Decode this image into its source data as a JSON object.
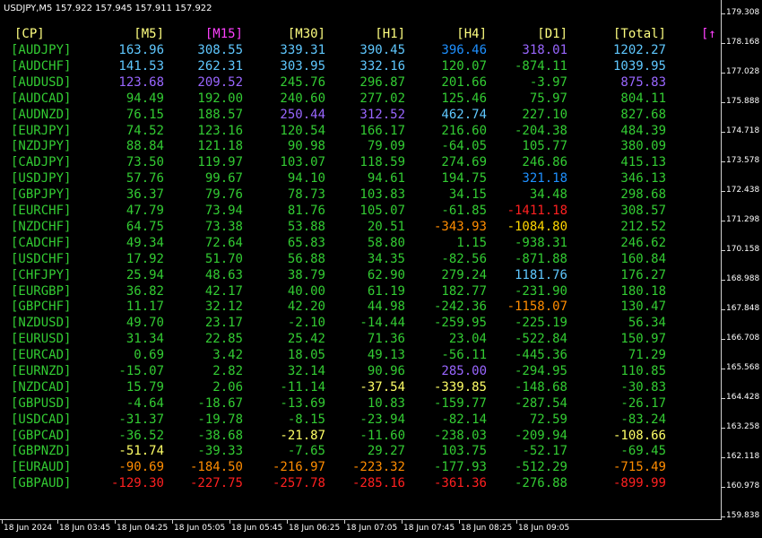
{
  "chart_title": "USDJPY,M5  157.922 157.945 157.911 157.922",
  "colors": {
    "background": "#000000",
    "axis": "#d0d0d0"
  },
  "headers": [
    {
      "text": "[CP]",
      "color": "#ffff80"
    },
    {
      "text": "[M5]",
      "color": "#ffff80"
    },
    {
      "text": "[M15]",
      "color": "#ff40ff"
    },
    {
      "text": "[M30]",
      "color": "#ffff80"
    },
    {
      "text": "[H1]",
      "color": "#ffff80"
    },
    {
      "text": "[H4]",
      "color": "#ffff80"
    },
    {
      "text": "[D1]",
      "color": "#ffff80"
    },
    {
      "text": "[Total]",
      "color": "#ffff80"
    },
    {
      "text": "[↑",
      "color": "#ff40ff"
    }
  ],
  "rows": [
    {
      "pair": "[AUDJPY]",
      "v": [
        "163.96",
        "308.55",
        "339.31",
        "390.45",
        "396.46",
        "318.01",
        "1202.27"
      ],
      "c": [
        "#5fc8ff",
        "#5fc8ff",
        "#5fc8ff",
        "#5fc8ff",
        "#1e90ff",
        "#9966ff",
        "#5fc8ff"
      ]
    },
    {
      "pair": "[AUDCHF]",
      "v": [
        "141.53",
        "262.31",
        "303.95",
        "332.16",
        "120.07",
        "-874.11",
        "1039.95"
      ],
      "c": [
        "#5fc8ff",
        "#5fc8ff",
        "#5fc8ff",
        "#5fc8ff",
        "#33cc33",
        "#33cc33",
        "#5fc8ff"
      ]
    },
    {
      "pair": "[AUDUSD]",
      "v": [
        "123.68",
        "209.52",
        "245.76",
        "296.87",
        "201.66",
        "-3.97",
        "875.83"
      ],
      "c": [
        "#9966ff",
        "#9966ff",
        "#33cc33",
        "#33cc33",
        "#33cc33",
        "#33cc33",
        "#9966ff"
      ]
    },
    {
      "pair": "[AUDCAD]",
      "v": [
        "94.49",
        "192.00",
        "240.60",
        "277.02",
        "125.46",
        "75.97",
        "804.11"
      ],
      "c": [
        "#33cc33",
        "#33cc33",
        "#33cc33",
        "#33cc33",
        "#33cc33",
        "#33cc33",
        "#33cc33"
      ]
    },
    {
      "pair": "[AUDNZD]",
      "v": [
        "76.15",
        "188.57",
        "250.44",
        "312.52",
        "462.74",
        "227.10",
        "827.68"
      ],
      "c": [
        "#33cc33",
        "#33cc33",
        "#9966ff",
        "#9966ff",
        "#5fc8ff",
        "#33cc33",
        "#33cc33"
      ]
    },
    {
      "pair": "[EURJPY]",
      "v": [
        "74.52",
        "123.16",
        "120.54",
        "166.17",
        "216.60",
        "-204.38",
        "484.39"
      ],
      "c": [
        "#33cc33",
        "#33cc33",
        "#33cc33",
        "#33cc33",
        "#33cc33",
        "#33cc33",
        "#33cc33"
      ]
    },
    {
      "pair": "[NZDJPY]",
      "v": [
        "88.84",
        "121.18",
        "90.98",
        "79.09",
        "-64.05",
        "105.77",
        "380.09"
      ],
      "c": [
        "#33cc33",
        "#33cc33",
        "#33cc33",
        "#33cc33",
        "#33cc33",
        "#33cc33",
        "#33cc33"
      ]
    },
    {
      "pair": "[CADJPY]",
      "v": [
        "73.50",
        "119.97",
        "103.07",
        "118.59",
        "274.69",
        "246.86",
        "415.13"
      ],
      "c": [
        "#33cc33",
        "#33cc33",
        "#33cc33",
        "#33cc33",
        "#33cc33",
        "#33cc33",
        "#33cc33"
      ]
    },
    {
      "pair": "[USDJPY]",
      "v": [
        "57.76",
        "99.67",
        "94.10",
        "94.61",
        "194.75",
        "321.18",
        "346.13"
      ],
      "c": [
        "#33cc33",
        "#33cc33",
        "#33cc33",
        "#33cc33",
        "#33cc33",
        "#1e90ff",
        "#33cc33"
      ]
    },
    {
      "pair": "[GBPJPY]",
      "v": [
        "36.37",
        "79.76",
        "78.73",
        "103.83",
        "34.15",
        "34.48",
        "298.68"
      ],
      "c": [
        "#33cc33",
        "#33cc33",
        "#33cc33",
        "#33cc33",
        "#33cc33",
        "#33cc33",
        "#33cc33"
      ]
    },
    {
      "pair": "[EURCHF]",
      "v": [
        "47.79",
        "73.94",
        "81.76",
        "105.07",
        "-61.85",
        "-1411.18",
        "308.57"
      ],
      "c": [
        "#33cc33",
        "#33cc33",
        "#33cc33",
        "#33cc33",
        "#33cc33",
        "#ff2020",
        "#33cc33"
      ]
    },
    {
      "pair": "[NZDCHF]",
      "v": [
        "64.75",
        "73.38",
        "53.88",
        "20.51",
        "-343.93",
        "-1084.80",
        "212.52"
      ],
      "c": [
        "#33cc33",
        "#33cc33",
        "#33cc33",
        "#33cc33",
        "#ff8c00",
        "#ffd700",
        "#33cc33"
      ]
    },
    {
      "pair": "[CADCHF]",
      "v": [
        "49.34",
        "72.64",
        "65.83",
        "58.80",
        "1.15",
        "-938.31",
        "246.62"
      ],
      "c": [
        "#33cc33",
        "#33cc33",
        "#33cc33",
        "#33cc33",
        "#33cc33",
        "#33cc33",
        "#33cc33"
      ]
    },
    {
      "pair": "[USDCHF]",
      "v": [
        "17.92",
        "51.70",
        "56.88",
        "34.35",
        "-82.56",
        "-871.88",
        "160.84"
      ],
      "c": [
        "#33cc33",
        "#33cc33",
        "#33cc33",
        "#33cc33",
        "#33cc33",
        "#33cc33",
        "#33cc33"
      ]
    },
    {
      "pair": "[CHFJPY]",
      "v": [
        "25.94",
        "48.63",
        "38.79",
        "62.90",
        "279.24",
        "1181.76",
        "176.27"
      ],
      "c": [
        "#33cc33",
        "#33cc33",
        "#33cc33",
        "#33cc33",
        "#33cc33",
        "#5fc8ff",
        "#33cc33"
      ]
    },
    {
      "pair": "[EURGBP]",
      "v": [
        "36.82",
        "42.17",
        "40.00",
        "61.19",
        "182.77",
        "-231.90",
        "180.18"
      ],
      "c": [
        "#33cc33",
        "#33cc33",
        "#33cc33",
        "#33cc33",
        "#33cc33",
        "#33cc33",
        "#33cc33"
      ]
    },
    {
      "pair": "[GBPCHF]",
      "v": [
        "11.17",
        "32.12",
        "42.20",
        "44.98",
        "-242.36",
        "-1158.07",
        "130.47"
      ],
      "c": [
        "#33cc33",
        "#33cc33",
        "#33cc33",
        "#33cc33",
        "#33cc33",
        "#ff8c00",
        "#33cc33"
      ]
    },
    {
      "pair": "[NZDUSD]",
      "v": [
        "49.70",
        "23.17",
        "-2.10",
        "-14.44",
        "-259.95",
        "-225.19",
        "56.34"
      ],
      "c": [
        "#33cc33",
        "#33cc33",
        "#33cc33",
        "#33cc33",
        "#33cc33",
        "#33cc33",
        "#33cc33"
      ]
    },
    {
      "pair": "[EURUSD]",
      "v": [
        "31.34",
        "22.85",
        "25.42",
        "71.36",
        "23.04",
        "-522.84",
        "150.97"
      ],
      "c": [
        "#33cc33",
        "#33cc33",
        "#33cc33",
        "#33cc33",
        "#33cc33",
        "#33cc33",
        "#33cc33"
      ]
    },
    {
      "pair": "[EURCAD]",
      "v": [
        "0.69",
        "3.42",
        "18.05",
        "49.13",
        "-56.11",
        "-445.36",
        "71.29"
      ],
      "c": [
        "#33cc33",
        "#33cc33",
        "#33cc33",
        "#33cc33",
        "#33cc33",
        "#33cc33",
        "#33cc33"
      ]
    },
    {
      "pair": "[EURNZD]",
      "v": [
        "-15.07",
        "2.82",
        "32.14",
        "90.96",
        "285.00",
        "-294.95",
        "110.85"
      ],
      "c": [
        "#33cc33",
        "#33cc33",
        "#33cc33",
        "#33cc33",
        "#9966ff",
        "#33cc33",
        "#33cc33"
      ]
    },
    {
      "pair": "[NZDCAD]",
      "v": [
        "15.79",
        "2.06",
        "-11.14",
        "-37.54",
        "-339.85",
        "-148.68",
        "-30.83"
      ],
      "c": [
        "#33cc33",
        "#33cc33",
        "#33cc33",
        "#ffff66",
        "#ffff66",
        "#33cc33",
        "#33cc33"
      ]
    },
    {
      "pair": "[GBPUSD]",
      "v": [
        "-4.64",
        "-18.67",
        "-13.69",
        "10.83",
        "-159.77",
        "-287.54",
        "-26.17"
      ],
      "c": [
        "#33cc33",
        "#33cc33",
        "#33cc33",
        "#33cc33",
        "#33cc33",
        "#33cc33",
        "#33cc33"
      ]
    },
    {
      "pair": "[USDCAD]",
      "v": [
        "-31.37",
        "-19.78",
        "-8.15",
        "-23.94",
        "-82.14",
        "72.59",
        "-83.24"
      ],
      "c": [
        "#33cc33",
        "#33cc33",
        "#33cc33",
        "#33cc33",
        "#33cc33",
        "#33cc33",
        "#33cc33"
      ]
    },
    {
      "pair": "[GBPCAD]",
      "v": [
        "-36.52",
        "-38.68",
        "-21.87",
        "-11.60",
        "-238.03",
        "-209.94",
        "-108.66"
      ],
      "c": [
        "#33cc33",
        "#33cc33",
        "#ffff66",
        "#33cc33",
        "#33cc33",
        "#33cc33",
        "#ffff66"
      ]
    },
    {
      "pair": "[GBPNZD]",
      "v": [
        "-51.74",
        "-39.33",
        "-7.65",
        "29.27",
        "103.75",
        "-52.17",
        "-69.45"
      ],
      "c": [
        "#ffff66",
        "#33cc33",
        "#33cc33",
        "#33cc33",
        "#33cc33",
        "#33cc33",
        "#33cc33"
      ]
    },
    {
      "pair": "[EURAUD]",
      "v": [
        "-90.69",
        "-184.50",
        "-216.97",
        "-223.32",
        "-177.93",
        "-512.29",
        "-715.49"
      ],
      "c": [
        "#ff8c00",
        "#ff8c00",
        "#ff8c00",
        "#ff8c00",
        "#33cc33",
        "#33cc33",
        "#ff8c00"
      ]
    },
    {
      "pair": "[GBPAUD]",
      "v": [
        "-129.30",
        "-227.75",
        "-257.78",
        "-285.16",
        "-361.36",
        "-276.88",
        "-899.99"
      ],
      "c": [
        "#ff2020",
        "#ff2020",
        "#ff2020",
        "#ff2020",
        "#ff2020",
        "#33cc33",
        "#ff2020"
      ]
    }
  ],
  "price_axis": [
    "179.308",
    "178.168",
    "177.028",
    "175.888",
    "174.718",
    "173.578",
    "172.438",
    "171.298",
    "170.158",
    "168.988",
    "167.848",
    "166.708",
    "165.568",
    "164.428",
    "163.258",
    "162.118",
    "160.978",
    "159.838"
  ],
  "time_axis": [
    "18 Jun 2024",
    "18 Jun 03:45",
    "18 Jun 04:25",
    "18 Jun 05:05",
    "18 Jun 05:45",
    "18 Jun 06:25",
    "18 Jun 07:05",
    "18 Jun 07:45",
    "18 Jun 08:25",
    "18 Jun 09:05"
  ]
}
